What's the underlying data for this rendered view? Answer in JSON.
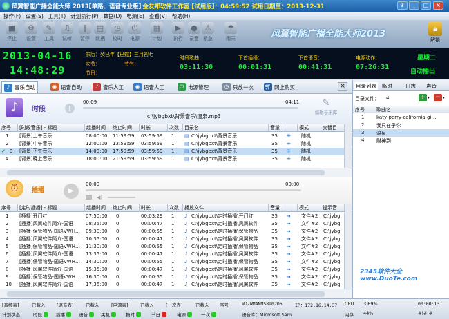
{
  "window": {
    "title": "风翼智能广播全能大师 2013[单路、语音专业版]",
    "info": "金友邦软件工作室 [试用版]：04:59:52 试用日期至：2013-12-31"
  },
  "menu": [
    "操作(F)",
    "设置(S)",
    "工具(T)",
    "计划执行(P)",
    "数据(D)",
    "电源(E)",
    "查看(V)",
    "帮助(H)"
  ],
  "toolbar": [
    {
      "label": "停止",
      "icon": "stop-icon"
    },
    {
      "label": "设置",
      "icon": "settings-icon"
    },
    {
      "label": "工具",
      "icon": "tools-icon"
    },
    {
      "label": "试听",
      "icon": "listen-icon"
    },
    {
      "label": "暂停",
      "icon": "pause-icon"
    },
    {
      "label": "数据",
      "icon": "database-icon"
    },
    {
      "label": "校时",
      "icon": "clock-icon"
    },
    {
      "label": "电源",
      "icon": "power-icon"
    },
    {
      "label": "计划",
      "icon": "plan-icon"
    },
    {
      "label": "执行",
      "icon": "execute-icon"
    },
    {
      "label": "录音",
      "icon": "record-icon"
    },
    {
      "label": "紧急",
      "icon": "emergency-icon"
    },
    {
      "label": "雨天",
      "icon": "rain-icon"
    }
  ],
  "brand": "风翼智能广播全能大师2013",
  "unlock": "解锁",
  "dashboard": {
    "date": "2013-04-16",
    "time": "14:48:29",
    "lunar": "农历：癸巳年【巳蛇】三月初七",
    "lunar_label2": "农节：",
    "solar_term": "节气：",
    "holiday": "节日：",
    "cols": [
      {
        "label": "时段歌曲：",
        "value": "03:11:30"
      },
      {
        "label": "下首插播：",
        "value": "00:01:31"
      },
      {
        "label": "下首语音：",
        "value": "00:41:31"
      },
      {
        "label": "电源动作：",
        "value": "07:26:31"
      }
    ],
    "weekday": "星期二",
    "mode": "自动播出"
  },
  "tabs": [
    "音乐自动",
    "语音自动",
    "音乐人工",
    "语音人工",
    "电源管理",
    "只放一次",
    "网上购买"
  ],
  "player1": {
    "title": "时段",
    "elapsed": "00:09",
    "total": "04:11",
    "file": "c:\\jybgbxt\\背景音乐\\温泉.mp3",
    "edit": "编辑音乐库"
  },
  "table1": {
    "headers": [
      "序号",
      "[时段音乐] - 标题",
      "起播时间",
      "终止时间",
      "时长",
      "次数",
      "目录名",
      "音量",
      "模式",
      "交替目"
    ],
    "rows": [
      [
        "1",
        "[背景]上午音乐",
        "08:00:00",
        "11:59:59",
        "03:59:59",
        "1",
        "C:\\jybgbxt\\背景音乐",
        "35",
        "随机",
        ""
      ],
      [
        "2",
        "[背景]中午音乐",
        "12:00:00",
        "13:59:59",
        "03:59:59",
        "1",
        "C:\\jybgbxt\\背景音乐",
        "35",
        "随机",
        ""
      ],
      [
        "3",
        "[背景]下午音乐",
        "14:00:00",
        "17:59:59",
        "03:59:59",
        "1",
        "C:\\jybgbxt\\背景音乐",
        "35",
        "随机",
        ""
      ],
      [
        "4",
        "[背景]晚上音乐",
        "18:00:00",
        "21:59:59",
        "03:59:59",
        "1",
        "C:\\jybgbxt\\背景音乐",
        "35",
        "随机",
        ""
      ]
    ]
  },
  "player2": {
    "title": "插播",
    "elapsed": "00:00",
    "total": "00:00"
  },
  "table2": {
    "headers": [
      "序号",
      "[定时插播] - 标题",
      "起播时间",
      "终止时间",
      "时长",
      "次数",
      "播放文件",
      "音量",
      "",
      "模式",
      "提示音"
    ],
    "rows": [
      [
        "1",
        "[插播]开门红",
        "07:50:00",
        "0",
        "00:03:29",
        "1",
        "C:\\jybgbxt\\定时插播\\开门红",
        "35",
        "",
        "文件#2",
        "C:\\jybgl"
      ],
      [
        "2",
        "[插播]风翼软件简介-国语",
        "08:35:00",
        "0",
        "00:00:47",
        "1",
        "C:\\jybgbxt\\定时插播\\风翼软件",
        "35",
        "",
        "文件#2",
        "C:\\jybgl"
      ],
      [
        "3",
        "[插播]保管物品-国语VWH…",
        "09:30:00",
        "0",
        "00:00:55",
        "1",
        "C:\\jybgbxt\\定时插播\\保管物品",
        "35",
        "",
        "文件#2",
        "C:\\jybgl"
      ],
      [
        "4",
        "[插播]风翼软件简介-国语",
        "10:35:00",
        "0",
        "00:00:47",
        "1",
        "C:\\jybgbxt\\定时插播\\风翼软件",
        "35",
        "",
        "文件#2",
        "C:\\jybgl"
      ],
      [
        "5",
        "[插播]保管物品-国语VWH…",
        "11:30:00",
        "0",
        "00:00:55",
        "1",
        "C:\\jybgbxt\\定时插播\\保管物品",
        "35",
        "",
        "文件#2",
        "C:\\jybgl"
      ],
      [
        "6",
        "[插播]风翼软件简介-国语",
        "13:35:00",
        "0",
        "00:00:47",
        "1",
        "C:\\jybgbxt\\定时插播\\风翼软件",
        "35",
        "",
        "文件#2",
        "C:\\jybgl"
      ],
      [
        "7",
        "[插播]保管物品-国语VWH…",
        "14:30:00",
        "0",
        "00:00:55",
        "1",
        "C:\\jybgbxt\\定时插播\\保管物品",
        "35",
        "",
        "文件#2",
        "C:\\jybgl"
      ],
      [
        "8",
        "[插播]风翼软件简介-国语",
        "15:35:00",
        "0",
        "00:00:47",
        "1",
        "C:\\jybgbxt\\定时插播\\风翼软件",
        "35",
        "",
        "文件#2",
        "C:\\jybgl"
      ],
      [
        "9",
        "[插播]保管物品-国语VWH…",
        "16:30:00",
        "0",
        "00:00:55",
        "1",
        "C:\\jybgbxt\\定时插播\\保管物品",
        "35",
        "",
        "文件#2",
        "C:\\jybgl"
      ],
      [
        "10",
        "[插播]风翼软件简介-国语",
        "17:35:00",
        "0",
        "00:00:47",
        "1",
        "C:\\jybgbxt\\定时插播\\风翼软件",
        "35",
        "",
        "文件#2",
        "C:\\jybgl"
      ]
    ]
  },
  "right": {
    "tabs": [
      "目录列表",
      "临时",
      "日志",
      "声音"
    ],
    "file_count_label": "目录文件：",
    "file_count": "4",
    "headers": [
      "序号",
      "歌曲名"
    ],
    "rows": [
      [
        "1",
        "katy-perry-california-gi…"
      ],
      [
        "2",
        "我只在乎你"
      ],
      [
        "3",
        "温泉"
      ],
      [
        "4",
        "财神到"
      ]
    ]
  },
  "status": {
    "row1": [
      "[音频表]",
      "已载入",
      "[语音表]",
      "已载入",
      "[电源表]",
      "已载入",
      "[一次表]",
      "已载入",
      "序号",
      "WD-WMANM5890206",
      "IP：172.16.14.37",
      "CPU",
      "3.69%",
      "00:00:13"
    ],
    "row2": [
      "计划状态",
      "时段",
      "插播",
      "语音",
      "关机",
      "报时",
      "节日",
      "电源",
      "一次",
      "语音库：Microsoft Sam",
      "内存",
      "44%",
      "#!#:#"
    ]
  },
  "watermark": "2345软件大全 www.DuoTe.com"
}
